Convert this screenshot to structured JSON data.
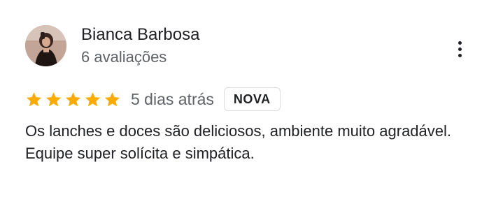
{
  "author": {
    "name": "Bianca Barbosa",
    "meta": "6 avaliações"
  },
  "review": {
    "rating": 5,
    "max_rating": 5,
    "date": "5 dias atrás",
    "badge": "NOVA",
    "lines": [
      "Os lanches e doces são deliciosos, ambiente muito agradável.",
      "Equipe super solícita e simpática."
    ]
  },
  "icons": {
    "more": "more-vert-icon",
    "star": "star-icon"
  },
  "colors": {
    "star": "#f9ab00",
    "name": "#202124",
    "secondary_text": "#5f6368",
    "badge_border": "#dadce0"
  }
}
